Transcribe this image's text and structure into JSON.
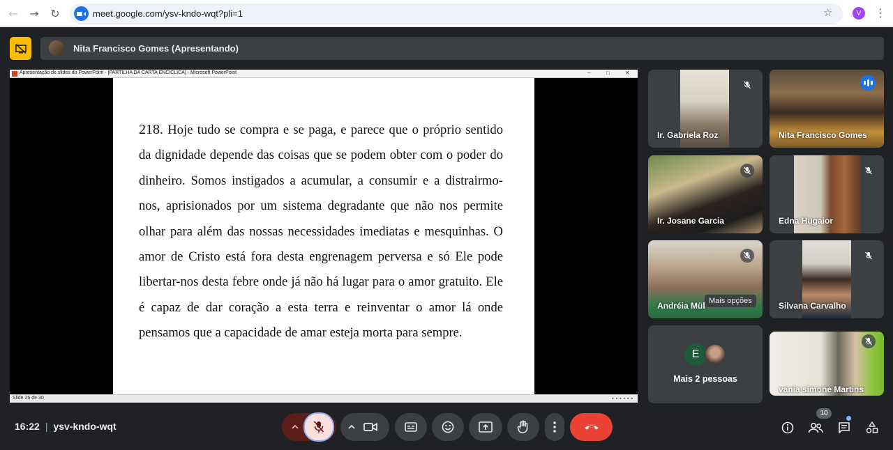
{
  "browser": {
    "url": "meet.google.com/ysv-kndo-wqt?pli=1",
    "profile_initial": "V"
  },
  "header": {
    "presenter_label": "Nita Francisco Gomes (Apresentando)"
  },
  "presentation": {
    "window_title": "Apresentação de slides do PowerPoint - [PARTILHA DA CARTA ENCÍCLICA] - Microsoft PowerPoint",
    "paragraph_number": "218.",
    "paragraph_text": "Hoje tudo se compra e se paga, e parece que o próprio sentido da dignidade depende das coisas que se podem obter com o poder do dinheiro. Somos instigados a acumular, a consumir e a distrairmo-nos, aprisionados por um sistema degradante que não nos permite olhar para além das nossas necessidades imediatas e mesquinhas. O amor de Cristo está fora desta engrenagem perversa e só Ele pode libertar-nos desta febre onde já não há lugar para o amor gratuito. Ele é capaz de dar coração a esta terra e reinventar o amor lá onde pensamos que a capacidade de amar esteja morta para sempre.",
    "status_text": "Slide 26 de 30"
  },
  "participants": [
    {
      "name": "Ir. Gabriela Roz",
      "muted": true
    },
    {
      "name": "Nita Francisco Gomes",
      "muted": false,
      "speaking": true
    },
    {
      "name": "Ir. Josane Garcia",
      "muted": true
    },
    {
      "name": "Edna Hugaior",
      "muted": true
    },
    {
      "name": "Andréia Mül",
      "muted": true
    },
    {
      "name": "Silvana Carvalho",
      "muted": true
    },
    {
      "name": "vania simone Martins",
      "muted": true
    }
  ],
  "more_people": {
    "initial": "E",
    "label": "Mais 2 pessoas"
  },
  "tooltip": "Mais opções",
  "footer": {
    "time": "16:22",
    "meeting_code": "ysv-kndo-wqt",
    "participant_count": "10"
  },
  "colors": {
    "end_call": "#ea4335",
    "mic_active_bg": "#f9dedc",
    "present_badge": "#fbbc04",
    "speaking_outline": "#8ab4f8"
  }
}
